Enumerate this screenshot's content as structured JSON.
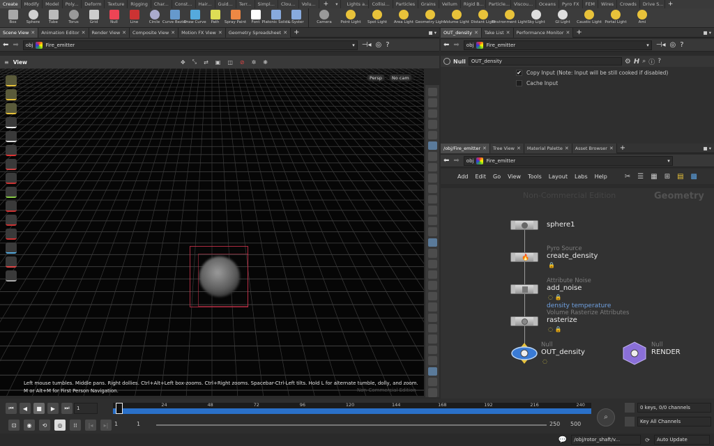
{
  "shelf": {
    "tabs_left": [
      "Create",
      "Modify",
      "Model",
      "Poly...",
      "Deform",
      "Texture",
      "Rigging",
      "Char...",
      "Const...",
      "Hair...",
      "Guid...",
      "Terr...",
      "Simpl...",
      "Clou...",
      "Volu..."
    ],
    "tabs_right": [
      "Lights a...",
      "Collisi...",
      "Particles",
      "Grains",
      "Vellum",
      "Rigid B...",
      "Particle...",
      "Viscou...",
      "Oceans",
      "Pyro FX",
      "FEM",
      "Wires",
      "Crowds",
      "Drive S..."
    ],
    "tools_left": [
      "Box",
      "Sphere",
      "Tube",
      "Torus",
      "Grid",
      "Null",
      "Line",
      "Circle",
      "Curve Bezier",
      "Draw Curve",
      "Path",
      "Spray Paint",
      "Font",
      "Platonic Solids",
      "L-Syster"
    ],
    "tools_right": [
      "Camera",
      "Point Light",
      "Spot Light",
      "Area Light",
      "Geometry Light",
      "Volume Light",
      "Distant Light",
      "Environment Light",
      "Sky Light",
      "GI Light",
      "Caustic Light",
      "Portal Light",
      "Ami"
    ]
  },
  "left_pane": {
    "tabs": [
      "Scene View",
      "Animation Editor",
      "Render View",
      "Composite View",
      "Motion FX View",
      "Geometry Spreadsheet"
    ],
    "path_root": "obj",
    "path_node": "Fire_emitter",
    "view_label": "View",
    "persp_label": "Persp",
    "cam_label": "No cam",
    "help_text": "Left mouse tumbles. Middle pans. Right dollies. Ctrl+Alt+Left box-zooms. Ctrl+Right zooms. Spacebar-Ctrl-Left tilts. Hold L for alternate tumble, dolly, and zoom.",
    "help_text2": "M or Alt+M for First Person Navigation.",
    "watermark": "Non-Commercial Edition"
  },
  "right_top": {
    "tabs": [
      "OUT_density",
      "Take List",
      "Performance Monitor"
    ],
    "path_root": "obj",
    "path_node": "Fire_emitter",
    "node_type": "Null",
    "node_name": "OUT_density",
    "copy_input_label": "Copy Input (Note: Input will be still cooked if disabled)",
    "copy_input_checked": true,
    "cache_input_label": "Cache Input",
    "cache_input_checked": false
  },
  "network": {
    "tabs": [
      "/obj/Fire_emitter",
      "Tree View",
      "Material Palette",
      "Asset Browser"
    ],
    "path_root": "obj",
    "path_node": "Fire_emitter",
    "menu": [
      "Add",
      "Edit",
      "Go",
      "View",
      "Tools",
      "Layout",
      "Labs",
      "Help"
    ],
    "watermark": "Non-Commercial Edition",
    "context_label": "Geometry",
    "nodes": [
      {
        "name": "sphere1",
        "type": ""
      },
      {
        "name": "create_density",
        "type": "Pyro Source"
      },
      {
        "name": "add_noise",
        "type": "Attribute Noise"
      },
      {
        "name": "rasterize",
        "type": "Volume Rasterize Attributes",
        "note": "density temperature"
      },
      {
        "name": "OUT_density",
        "type": "Null"
      },
      {
        "name": "RENDER",
        "type": "Null"
      }
    ]
  },
  "timeline": {
    "ticks": [
      "1",
      "24",
      "48",
      "72",
      "96",
      "120",
      "144",
      "168",
      "192",
      "216",
      "240"
    ],
    "current_frame": "1",
    "range_start": "1",
    "range_start2": "1",
    "range_end": "250",
    "range_end2": "500",
    "keys_label": "0 keys, 0/0 channels",
    "key_all_label": "Key All Channels"
  },
  "status": {
    "path": "/obj/rotor_shaft/v...",
    "update_mode": "Auto Update"
  },
  "colors": {
    "accent": "#3a7bd5",
    "timeline_bar": "#2a70c8",
    "bbox": "#d0354a"
  }
}
